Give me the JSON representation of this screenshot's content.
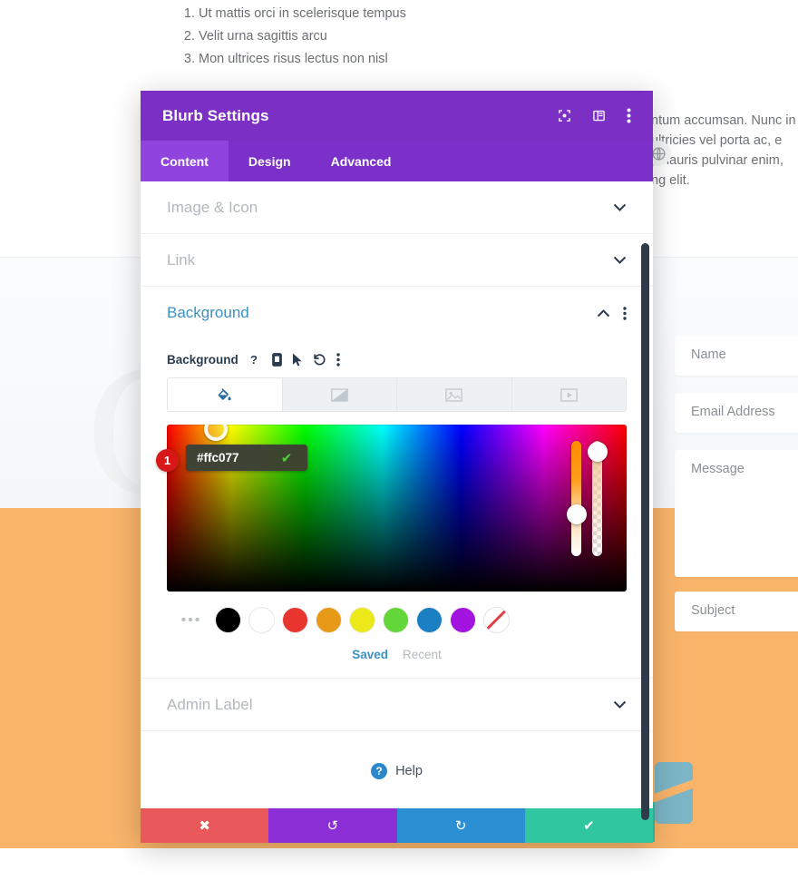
{
  "background_page": {
    "list_items": [
      "Ut mattis orci in scelerisque tempus",
      "Velit urna sagittis arcu",
      "Mon ultrices risus lectus non nisl"
    ],
    "paragraph_lines": [
      "ntum accumsan. Nunc in so",
      "ultricies vel porta ac, e",
      ", mauris pulvinar enim,",
      "ng elit."
    ],
    "big_letter": "C",
    "globe_icon": "globe-icon",
    "form_fields": [
      {
        "name": "name-field",
        "placeholder": "Name"
      },
      {
        "name": "email-field",
        "placeholder": "Email Address"
      },
      {
        "name": "message-field",
        "placeholder": "Message"
      },
      {
        "name": "subject-field",
        "placeholder": "Subject"
      }
    ],
    "colors": {
      "orange_band": "#f9b46a",
      "teal_shape": "#7cb6c6",
      "green_shape": "#2ec4a0",
      "scrollbar": "#2f3a4a"
    }
  },
  "modal": {
    "title": "Blurb Settings",
    "header_icons": [
      {
        "name": "focus-target-icon",
        "label": "focus"
      },
      {
        "name": "layout-panel-icon",
        "label": "layout"
      },
      {
        "name": "more-vertical-icon",
        "label": "more"
      }
    ],
    "tabs": [
      {
        "label": "Content",
        "active": true
      },
      {
        "label": "Design",
        "active": false
      },
      {
        "label": "Advanced",
        "active": false
      }
    ],
    "sections": [
      {
        "name": "image-and-icon",
        "label": "Image & Icon",
        "open": false
      },
      {
        "name": "link",
        "label": "Link",
        "open": false
      },
      {
        "name": "background",
        "label": "Background",
        "open": true
      },
      {
        "name": "admin-label",
        "label": "Admin Label",
        "open": false
      }
    ],
    "background_panel": {
      "field_label": "Background",
      "field_icons": [
        {
          "name": "help-question-icon",
          "glyph": "?"
        },
        {
          "name": "mobile-device-icon",
          "glyph": "mobile"
        },
        {
          "name": "cursor-pointer-icon",
          "glyph": "cursor"
        },
        {
          "name": "undo-reset-icon",
          "glyph": "undo"
        },
        {
          "name": "more-vertical-icon",
          "glyph": "dots"
        }
      ],
      "type_tabs": [
        {
          "name": "bg-color-tab",
          "icon": "paint-bucket-icon",
          "active": true
        },
        {
          "name": "bg-gradient-tab",
          "icon": "gradient-icon",
          "active": false
        },
        {
          "name": "bg-image-tab",
          "icon": "image-icon",
          "active": false
        },
        {
          "name": "bg-video-tab",
          "icon": "video-icon",
          "active": false
        }
      ],
      "color_value": "#ffc077",
      "confirm_glyph": "✔",
      "marker_number": "1",
      "swatches": [
        {
          "name": "swatch-black",
          "color": "#000000"
        },
        {
          "name": "swatch-white",
          "color": "#ffffff"
        },
        {
          "name": "swatch-red",
          "color": "#e8352e"
        },
        {
          "name": "swatch-orange",
          "color": "#e79a18"
        },
        {
          "name": "swatch-yellow",
          "color": "#ece81a"
        },
        {
          "name": "swatch-green",
          "color": "#63d639"
        },
        {
          "name": "swatch-blue",
          "color": "#1b7fc4"
        },
        {
          "name": "swatch-purple",
          "color": "#a414e0"
        },
        {
          "name": "swatch-transparent",
          "color": "transparent"
        }
      ],
      "dots_label": "•••",
      "palette_tabs": [
        {
          "label": "Saved",
          "active": true
        },
        {
          "label": "Recent",
          "active": false
        }
      ]
    },
    "help": {
      "label": "Help",
      "badge": "?"
    },
    "footer_buttons": [
      {
        "name": "cancel-button",
        "glyph": "✖",
        "color": "#e9595b"
      },
      {
        "name": "undo-button",
        "glyph": "↺",
        "color": "#8c2ed6"
      },
      {
        "name": "redo-button",
        "glyph": "↻",
        "color": "#2b8fd4"
      },
      {
        "name": "save-button",
        "glyph": "✔",
        "color": "#2fc6a0"
      }
    ]
  }
}
